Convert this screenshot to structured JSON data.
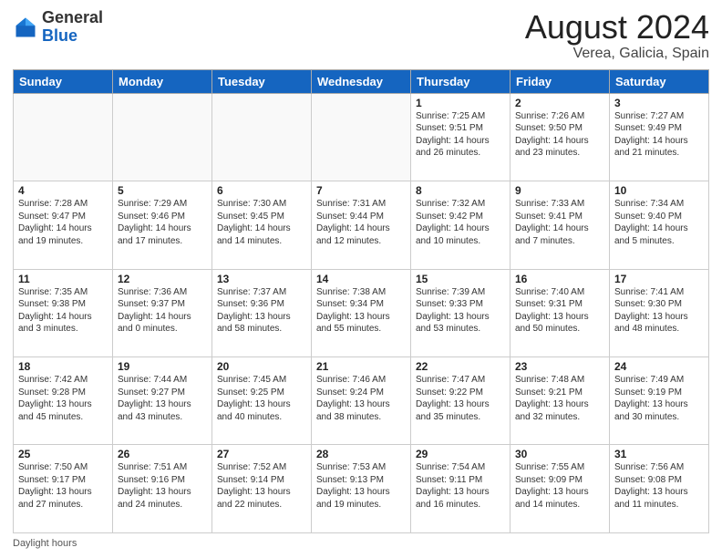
{
  "header": {
    "logo_general": "General",
    "logo_blue": "Blue",
    "month": "August 2024",
    "location": "Verea, Galicia, Spain"
  },
  "days_of_week": [
    "Sunday",
    "Monday",
    "Tuesday",
    "Wednesday",
    "Thursday",
    "Friday",
    "Saturday"
  ],
  "footer": {
    "daylight_label": "Daylight hours"
  },
  "weeks": [
    [
      {
        "day": "",
        "info": ""
      },
      {
        "day": "",
        "info": ""
      },
      {
        "day": "",
        "info": ""
      },
      {
        "day": "",
        "info": ""
      },
      {
        "day": "1",
        "info": "Sunrise: 7:25 AM\nSunset: 9:51 PM\nDaylight: 14 hours and 26 minutes."
      },
      {
        "day": "2",
        "info": "Sunrise: 7:26 AM\nSunset: 9:50 PM\nDaylight: 14 hours and 23 minutes."
      },
      {
        "day": "3",
        "info": "Sunrise: 7:27 AM\nSunset: 9:49 PM\nDaylight: 14 hours and 21 minutes."
      }
    ],
    [
      {
        "day": "4",
        "info": "Sunrise: 7:28 AM\nSunset: 9:47 PM\nDaylight: 14 hours and 19 minutes."
      },
      {
        "day": "5",
        "info": "Sunrise: 7:29 AM\nSunset: 9:46 PM\nDaylight: 14 hours and 17 minutes."
      },
      {
        "day": "6",
        "info": "Sunrise: 7:30 AM\nSunset: 9:45 PM\nDaylight: 14 hours and 14 minutes."
      },
      {
        "day": "7",
        "info": "Sunrise: 7:31 AM\nSunset: 9:44 PM\nDaylight: 14 hours and 12 minutes."
      },
      {
        "day": "8",
        "info": "Sunrise: 7:32 AM\nSunset: 9:42 PM\nDaylight: 14 hours and 10 minutes."
      },
      {
        "day": "9",
        "info": "Sunrise: 7:33 AM\nSunset: 9:41 PM\nDaylight: 14 hours and 7 minutes."
      },
      {
        "day": "10",
        "info": "Sunrise: 7:34 AM\nSunset: 9:40 PM\nDaylight: 14 hours and 5 minutes."
      }
    ],
    [
      {
        "day": "11",
        "info": "Sunrise: 7:35 AM\nSunset: 9:38 PM\nDaylight: 14 hours and 3 minutes."
      },
      {
        "day": "12",
        "info": "Sunrise: 7:36 AM\nSunset: 9:37 PM\nDaylight: 14 hours and 0 minutes."
      },
      {
        "day": "13",
        "info": "Sunrise: 7:37 AM\nSunset: 9:36 PM\nDaylight: 13 hours and 58 minutes."
      },
      {
        "day": "14",
        "info": "Sunrise: 7:38 AM\nSunset: 9:34 PM\nDaylight: 13 hours and 55 minutes."
      },
      {
        "day": "15",
        "info": "Sunrise: 7:39 AM\nSunset: 9:33 PM\nDaylight: 13 hours and 53 minutes."
      },
      {
        "day": "16",
        "info": "Sunrise: 7:40 AM\nSunset: 9:31 PM\nDaylight: 13 hours and 50 minutes."
      },
      {
        "day": "17",
        "info": "Sunrise: 7:41 AM\nSunset: 9:30 PM\nDaylight: 13 hours and 48 minutes."
      }
    ],
    [
      {
        "day": "18",
        "info": "Sunrise: 7:42 AM\nSunset: 9:28 PM\nDaylight: 13 hours and 45 minutes."
      },
      {
        "day": "19",
        "info": "Sunrise: 7:44 AM\nSunset: 9:27 PM\nDaylight: 13 hours and 43 minutes."
      },
      {
        "day": "20",
        "info": "Sunrise: 7:45 AM\nSunset: 9:25 PM\nDaylight: 13 hours and 40 minutes."
      },
      {
        "day": "21",
        "info": "Sunrise: 7:46 AM\nSunset: 9:24 PM\nDaylight: 13 hours and 38 minutes."
      },
      {
        "day": "22",
        "info": "Sunrise: 7:47 AM\nSunset: 9:22 PM\nDaylight: 13 hours and 35 minutes."
      },
      {
        "day": "23",
        "info": "Sunrise: 7:48 AM\nSunset: 9:21 PM\nDaylight: 13 hours and 32 minutes."
      },
      {
        "day": "24",
        "info": "Sunrise: 7:49 AM\nSunset: 9:19 PM\nDaylight: 13 hours and 30 minutes."
      }
    ],
    [
      {
        "day": "25",
        "info": "Sunrise: 7:50 AM\nSunset: 9:17 PM\nDaylight: 13 hours and 27 minutes."
      },
      {
        "day": "26",
        "info": "Sunrise: 7:51 AM\nSunset: 9:16 PM\nDaylight: 13 hours and 24 minutes."
      },
      {
        "day": "27",
        "info": "Sunrise: 7:52 AM\nSunset: 9:14 PM\nDaylight: 13 hours and 22 minutes."
      },
      {
        "day": "28",
        "info": "Sunrise: 7:53 AM\nSunset: 9:13 PM\nDaylight: 13 hours and 19 minutes."
      },
      {
        "day": "29",
        "info": "Sunrise: 7:54 AM\nSunset: 9:11 PM\nDaylight: 13 hours and 16 minutes."
      },
      {
        "day": "30",
        "info": "Sunrise: 7:55 AM\nSunset: 9:09 PM\nDaylight: 13 hours and 14 minutes."
      },
      {
        "day": "31",
        "info": "Sunrise: 7:56 AM\nSunset: 9:08 PM\nDaylight: 13 hours and 11 minutes."
      }
    ]
  ]
}
